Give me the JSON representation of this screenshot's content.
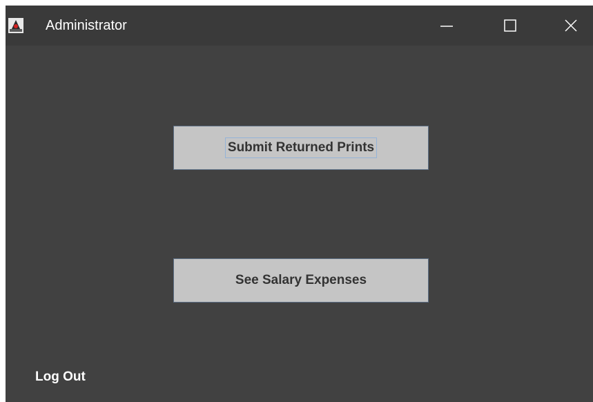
{
  "window": {
    "title": "Administrator",
    "icon": "java-duke-icon",
    "controls": [
      "minimize-icon",
      "maximize-icon",
      "close-icon"
    ]
  },
  "main": {
    "submit_returned_prints_label": "Submit Returned Prints",
    "see_salary_expenses_label": "See Salary Expenses",
    "log_out_label": "Log Out"
  },
  "colors": {
    "background": "#414141",
    "titlebar": "#3a3a3a",
    "button": "#c5c5c5",
    "button_text": "#333333",
    "text_light": "#ffffff"
  }
}
